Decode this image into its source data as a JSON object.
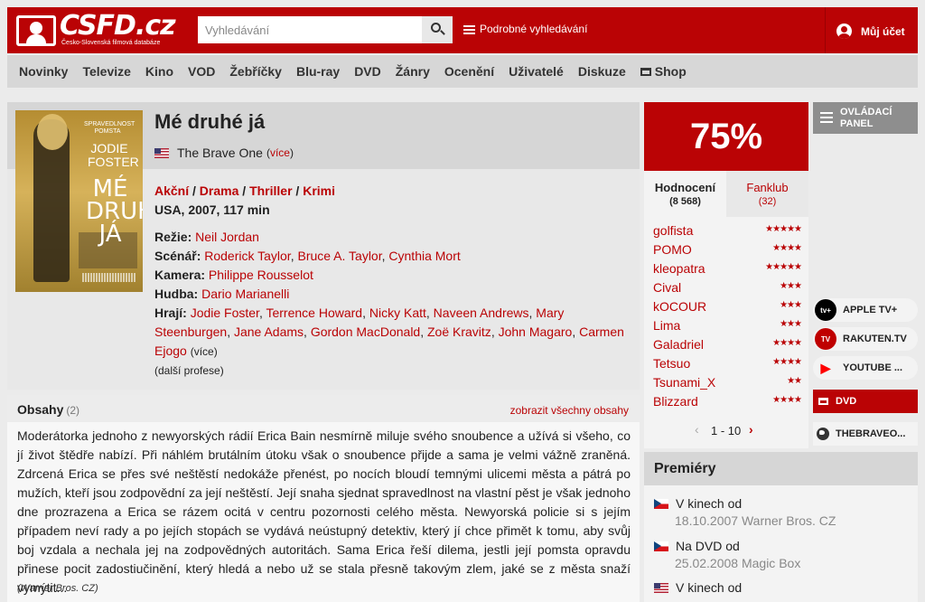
{
  "header": {
    "logo_text": "CSFD.cz",
    "logo_subtitle": "Česko-Slovenská filmová databáze",
    "search_placeholder": "Vyhledávání",
    "advanced_search": "Podrobné vyhledávání",
    "account": "Můj účet"
  },
  "nav": [
    "Novinky",
    "Televize",
    "Kino",
    "VOD",
    "Žebříčky",
    "Blu-ray",
    "DVD",
    "Žánry",
    "Ocenění",
    "Uživatelé",
    "Diskuze",
    "Shop"
  ],
  "film": {
    "title": "Mé druhé já",
    "original_title": "The Brave One",
    "original_more": "(více)",
    "genres": [
      "Akční",
      "Drama",
      "Thriller",
      "Krimi"
    ],
    "origin": "USA, 2007, 117 min",
    "poster": {
      "tagline": "SPRAVEDLNOST POMSTA",
      "actor": "JODIE FOSTER",
      "title": "MÉ DRUHÉ JÁ"
    },
    "creators": {
      "directing_label": "Režie:",
      "directing": [
        "Neil Jordan"
      ],
      "script_label": "Scénář:",
      "script": [
        "Roderick Taylor",
        "Bruce A. Taylor",
        "Cynthia Mort"
      ],
      "camera_label": "Kamera:",
      "camera": [
        "Philippe Rousselot"
      ],
      "music_label": "Hudba:",
      "music": [
        "Dario Marianelli"
      ],
      "cast_label": "Hrají:",
      "cast": [
        "Jodie Foster",
        "Terrence Howard",
        "Nicky Katt",
        "Naveen Andrews",
        "Mary Steenburgen",
        "Jane Adams",
        "Gordon MacDonald",
        "Zoë Kravitz",
        "John Magaro",
        "Carmen Ejogo"
      ],
      "cast_more": "(více)",
      "more_professions": "(další profese)"
    }
  },
  "plot": {
    "title": "Obsahy",
    "count": "(2)",
    "show_all": "zobrazit všechny obsahy",
    "text": "Moderátorka jednoho z newyorských rádií Erica Bain nesmírně miluje svého snoubence a užívá si všeho, co jí život štědře nabízí. Při náhlém brutálním útoku však o snoubence přijde a sama je velmi vážně zraněná. Zdrcená Erica se přes své neštěstí nedokáže přenést, po nocích bloudí temnými ulicemi města a pátrá po mužích, kteří jsou zodpovědní za její neštěstí. Její snaha sjednat spravedlnost na vlastní pěst je však jednoho dne prozrazena a Erica se rázem ocitá v centru pozornosti celého města. Newyorská policie si s jejím případem neví rady a po jejích stopách se vydává neústupný detektiv, který jí chce přimět k tomu, aby svůj boj vzdala a nechala jej na zodpovědných autoritách. Sama Erica řeší dilema, jestli její pomsta opravdu přinese pocit zadostiučinění, který hledá a nebo už se stala přesně takovým zlem, jaké se z města snaží vymýtit...",
    "source": "(Warner Bros. CZ)"
  },
  "rating": {
    "score": "75%",
    "tab_ratings": "Hodnocení",
    "tab_ratings_count": "(8 568)",
    "tab_fanclub": "Fanklub",
    "tab_fanclub_count": "(32)",
    "users": [
      {
        "name": "golfista",
        "stars": "★★★★★"
      },
      {
        "name": "POMO",
        "stars": "★★★★"
      },
      {
        "name": "kleopatra",
        "stars": "★★★★★"
      },
      {
        "name": "Cival",
        "stars": "★★★"
      },
      {
        "name": "kOCOUR",
        "stars": "★★★"
      },
      {
        "name": "Lima",
        "stars": "★★★"
      },
      {
        "name": "Galadriel",
        "stars": "★★★★"
      },
      {
        "name": "Tetsuo",
        "stars": "★★★★"
      },
      {
        "name": "Tsunami_X",
        "stars": "★★"
      },
      {
        "name": "Blizzard",
        "stars": "★★★★"
      }
    ],
    "pager": "1 - 10",
    "pager_prev": "‹",
    "pager_next": "›"
  },
  "side": {
    "control_panel": "OVLÁDACÍ PANEL",
    "vod": [
      {
        "label": "APPLE TV+",
        "icon": "apple-tv-icon",
        "color": "#000000",
        "badge": "tv+"
      },
      {
        "label": "RAKUTEN.TV",
        "icon": "rakuten-tv-icon",
        "color": "#bf0000",
        "badge": "TV"
      },
      {
        "label": "YOUTUBE ...",
        "icon": "youtube-icon",
        "color": "#ff0000",
        "badge": "▶"
      }
    ],
    "dvd": "DVD",
    "website": "THEBRAVEO..."
  },
  "premieres": {
    "title": "Premiéry",
    "items": [
      {
        "type": "V kinech od",
        "detail": "18.10.2007 Warner Bros. CZ"
      },
      {
        "type": "Na DVD od",
        "detail": "25.02.2008 Magic Box"
      },
      {
        "type": "V kinech od",
        "detail": ""
      }
    ]
  },
  "colors": {
    "brand": "#ba0305"
  }
}
